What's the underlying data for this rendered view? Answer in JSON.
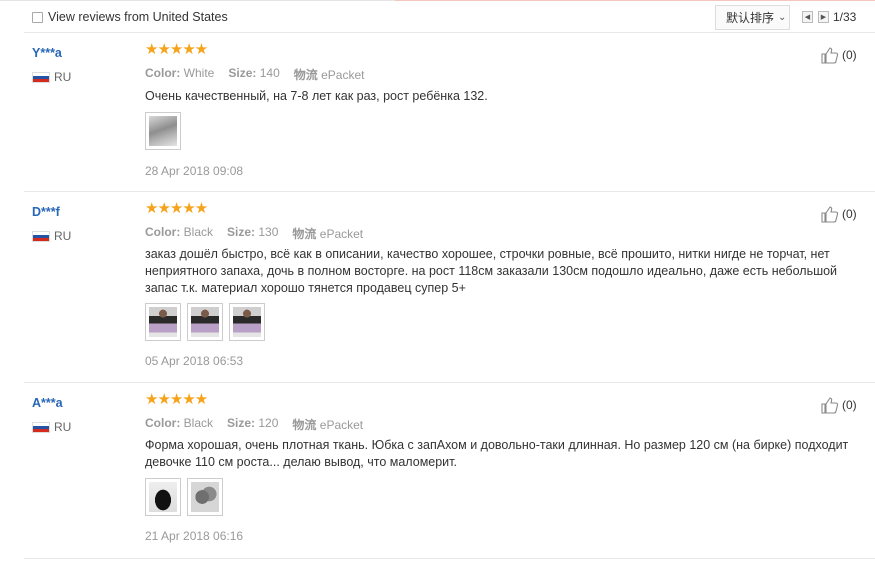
{
  "filter": {
    "label": "View reviews from United States",
    "checked": false
  },
  "sort": {
    "label": "默认排序"
  },
  "pager": {
    "text": "1/33"
  },
  "labels": {
    "color": "Color:",
    "size": "Size:",
    "shipping": "物流"
  },
  "reviews": [
    {
      "user": "Y***a",
      "country": "RU",
      "rating": 5,
      "stars": "★★★★★",
      "color": "White",
      "size": "140",
      "shipping": "ePacket",
      "text": "Очень качественный, на 7-8 лет как раз, рост ребёнка 132.",
      "photos": [
        "grey-dress-photo"
      ],
      "date": "28 Apr 2018 09:08",
      "likes": "(0)"
    },
    {
      "user": "D***f",
      "country": "RU",
      "rating": 5,
      "stars": "★★★★★",
      "color": "Black",
      "size": "130",
      "shipping": "ePacket",
      "text": "заказ дошёл быстро, всё как в описании, качество хорошее, строчки ровные, всё прошито, нитки нигде не торчат, нет неприятного запаха, дочь в полном восторге. на рост 118см заказали 130см подошло идеально, даже есть небольшой запас т.к. материал хорошо тянется продавец супер 5+",
      "photos": [
        "girl-in-dress-photo",
        "girl-in-dress-photo",
        "girl-in-dress-photo"
      ],
      "date": "05 Apr 2018 06:53",
      "likes": "(0)"
    },
    {
      "user": "A***a",
      "country": "RU",
      "rating": 5,
      "stars": "★★★★★",
      "color": "Black",
      "size": "120",
      "shipping": "ePacket",
      "text": "Форма хорошая, очень плотная ткань. Юбка с запАхом и довольно-таки длинная. Но размер 120 см (на бирке) подходит девочке 110 см роста... делаю вывод, что маломерит.",
      "photos": [
        "black-dress-photo",
        "grey-tulle-photo"
      ],
      "date": "21 Apr 2018 06:16",
      "likes": "(0)"
    }
  ]
}
